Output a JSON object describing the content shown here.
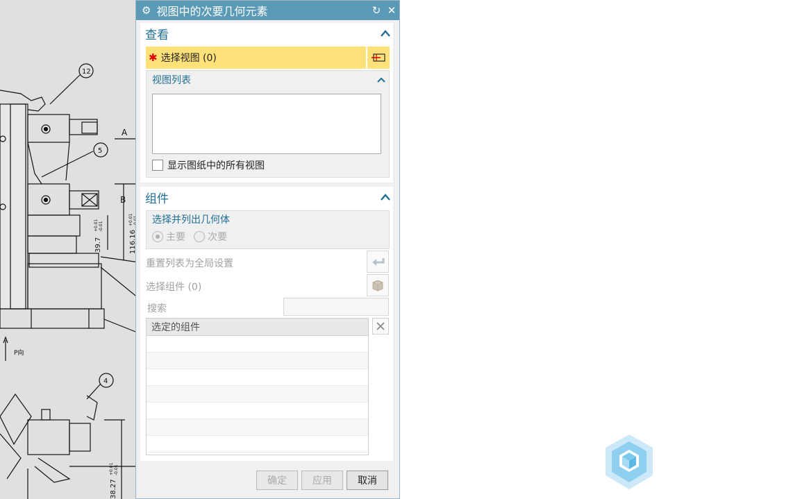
{
  "dialog": {
    "title": "视图中的次要几何元素",
    "icons": {
      "settings": "gear-icon",
      "reset": "refresh-icon",
      "close": "close-icon"
    }
  },
  "view_section": {
    "heading": "查看",
    "select_view_label": "选择视图 (0)",
    "view_list": {
      "heading": "视图列表",
      "items": [],
      "show_all_checkbox": {
        "label": "显示图纸中的所有视图",
        "checked": false
      }
    }
  },
  "component_section": {
    "heading": "组件",
    "geometry_list": {
      "heading": "选择并列出几何体",
      "options": [
        {
          "label": "主要",
          "selected": true
        },
        {
          "label": "次要",
          "selected": false
        }
      ]
    },
    "reset_list_label": "重置列表为全局设置",
    "select_component_label": "选择组件 (0)",
    "search_label": "搜索",
    "search_value": "",
    "table": {
      "column": "选定的组件",
      "rows": []
    }
  },
  "footer": {
    "ok_label": "确定",
    "apply_label": "应用",
    "cancel_label": "取消"
  },
  "drawing": {
    "balloons": [
      "12",
      "5",
      "4"
    ],
    "labels": [
      "A",
      "B",
      "P向",
      "39.7",
      "116.16",
      "38.27",
      "+0.01",
      "-0.01",
      "+0.01",
      "-0.01",
      "+0.01",
      "-0.01"
    ]
  },
  "colors": {
    "title_bar": "#5b9ab6",
    "section_heading": "#1f6e94",
    "selection_highlight": "#ffe17a",
    "required_star": "#e00000"
  }
}
